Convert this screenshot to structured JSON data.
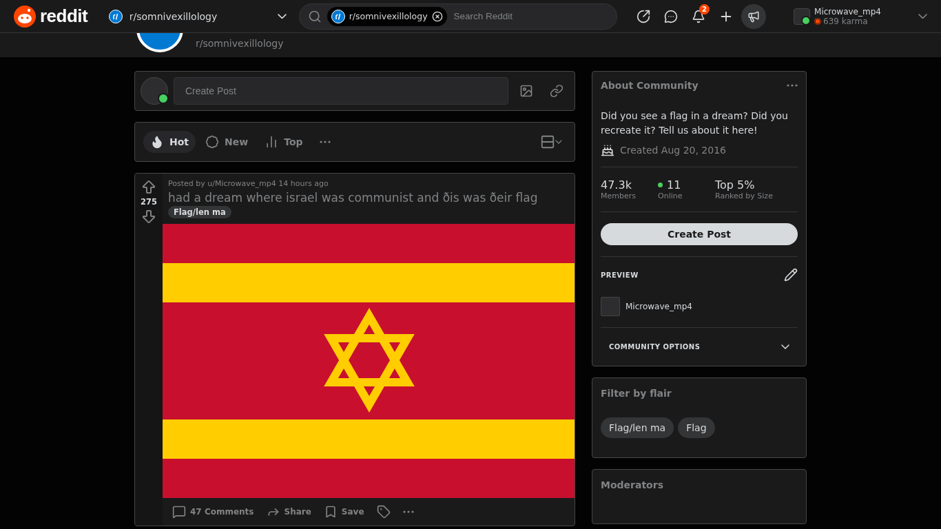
{
  "header": {
    "logo_text": "reddit",
    "community": "r/somnivexillology",
    "search": {
      "chip": "r/somnivexillology",
      "placeholder": "Search Reddit"
    },
    "notification_count": "2",
    "user": {
      "name": "Microwave_mp4",
      "karma": "639 karma",
      "online": true
    }
  },
  "banner": {
    "community": "r/somnivexillology"
  },
  "create_post": {
    "placeholder": "Create Post",
    "online": true
  },
  "sort_tabs": [
    {
      "label": "Hot",
      "kind": "hot",
      "selected": true
    },
    {
      "label": "New",
      "kind": "new",
      "selected": false
    },
    {
      "label": "Top",
      "kind": "top",
      "selected": false
    }
  ],
  "post": {
    "votes": "275",
    "meta": "Posted by u/Microwave_mp4 14 hours ago",
    "title": "had a dream where israel was communist and ðis was ðeir flag",
    "flair": "Flag/len ma",
    "actions": [
      {
        "kind": "comments",
        "label": "47 Comments"
      },
      {
        "kind": "share",
        "label": "Share"
      },
      {
        "kind": "save",
        "label": "Save"
      },
      {
        "kind": "tag"
      },
      {
        "kind": "more"
      }
    ]
  },
  "about": {
    "title": "About Community",
    "description": "Did you see a flag in a dream? Did you recreate it? Tell us about it here!",
    "created": "Created Aug 20, 2016",
    "stats": [
      {
        "value": "47.3k",
        "label": "Members",
        "kind": "plain"
      },
      {
        "value": "11",
        "label": "Online",
        "kind": "online"
      },
      {
        "value": "Top 5%",
        "label": "Ranked by Size",
        "kind": "plain"
      }
    ],
    "button": "Create Post",
    "preview_heading": "PREVIEW",
    "preview_user": "Microwave_mp4",
    "options": "COMMUNITY OPTIONS"
  },
  "flair_filter": {
    "title": "Filter by flair",
    "flairs": [
      "Flag/len ma",
      "Flag"
    ]
  },
  "moderators": {
    "title": "Moderators"
  }
}
